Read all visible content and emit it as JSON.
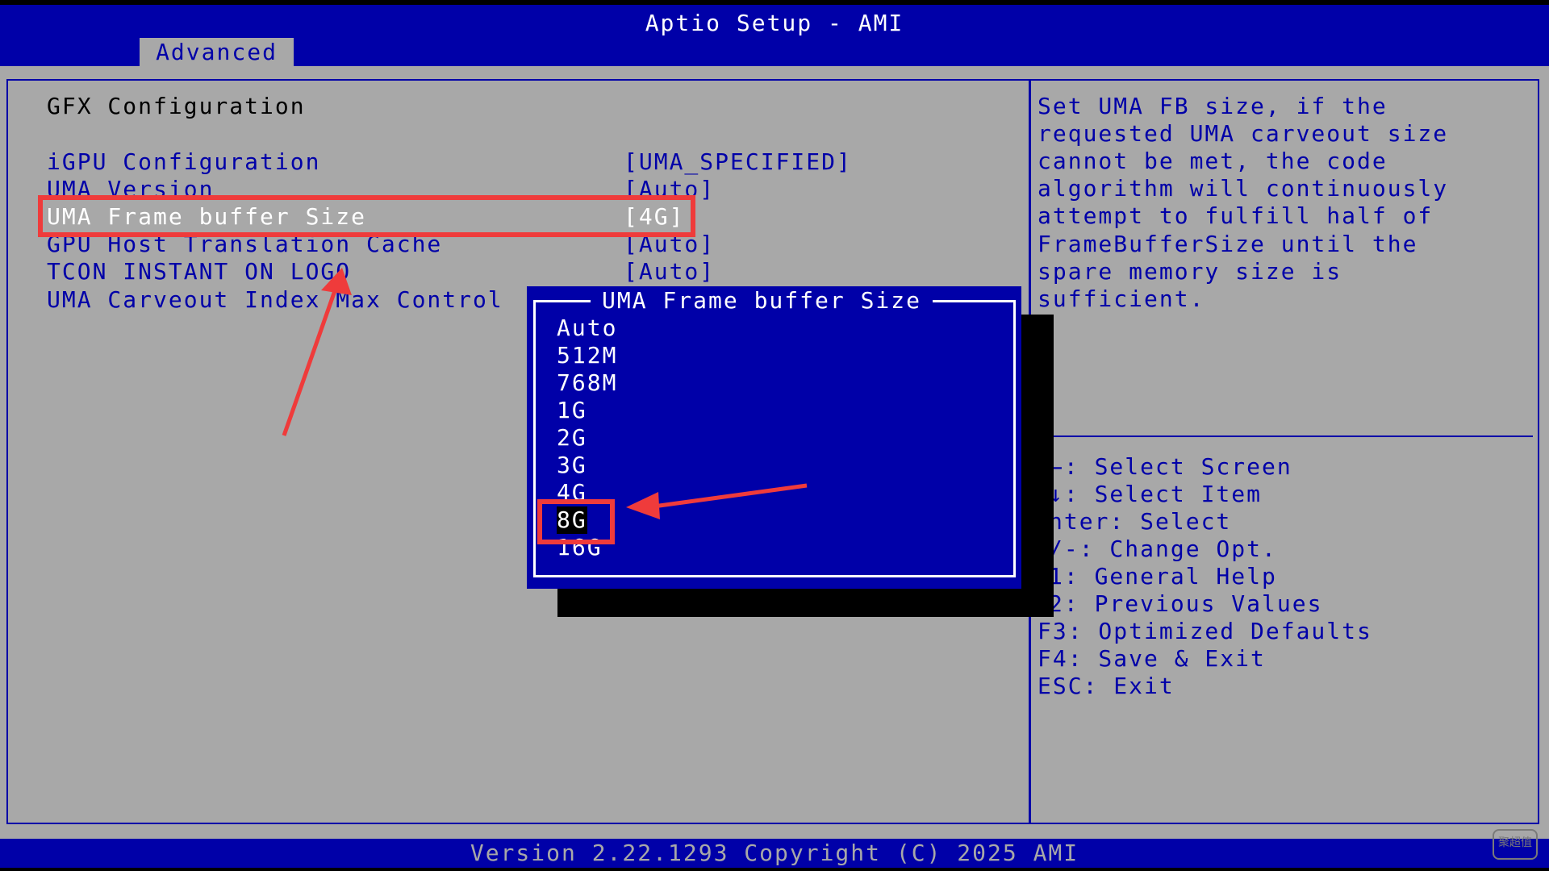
{
  "app": {
    "title": "Aptio Setup - AMI",
    "tab": "Advanced"
  },
  "section_title": "GFX Configuration",
  "settings": [
    {
      "label": "iGPU Configuration",
      "value": "[UMA_SPECIFIED]"
    },
    {
      "label": "UMA Version",
      "value": "[Auto]"
    },
    {
      "label": "UMA Frame buffer Size",
      "value": "[4G]"
    },
    {
      "label": "GPU Host Translation Cache",
      "value": "[Auto]"
    },
    {
      "label": "TCON INSTANT ON LOGO",
      "value": "[Auto]"
    },
    {
      "label": "UMA Carveout Index Max Control",
      "value": ""
    }
  ],
  "popup": {
    "title": "UMA Frame buffer Size",
    "options": [
      "Auto",
      "512M",
      "768M",
      "1G",
      "2G",
      "3G",
      "4G",
      "8G",
      "16G"
    ],
    "selected": "8G"
  },
  "help": [
    "Set UMA FB size, if the",
    "requested UMA carveout size",
    "cannot be met, the code",
    "algorithm will continuously",
    "attempt to fulfill half of",
    "FrameBufferSize until the",
    "spare memory size is",
    "sufficient."
  ],
  "keys": [
    "←: Select Screen",
    "↓: Select Item",
    "nter: Select",
    "/-: Change Opt.",
    "1: General Help",
    "2: Previous Values",
    "F3: Optimized Defaults",
    "F4: Save & Exit",
    "ESC: Exit"
  ],
  "footer": "Version 2.22.1293 Copyright (C) 2025 AMI",
  "watermark": "聚超值",
  "colors": {
    "bios_blue": "#0000a8",
    "bios_gray": "#a8a8a8",
    "annotation_red": "#ef3b3b"
  }
}
